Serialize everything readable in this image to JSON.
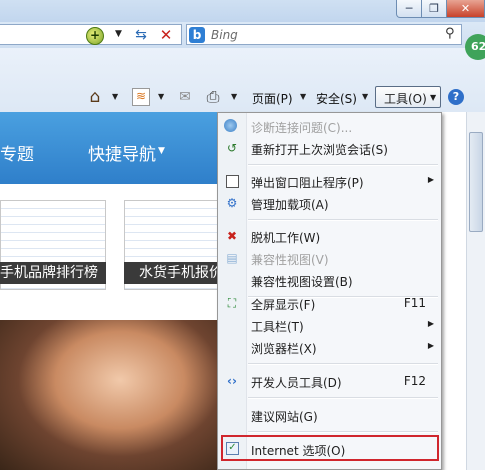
{
  "window": {
    "min_label": "─",
    "max_label": "❐",
    "close_label": "✕"
  },
  "address_bar": {
    "compat_glyph": "+",
    "dropdown_glyph": "▼",
    "refresh_glyph": "⇆",
    "stop_glyph": "✕"
  },
  "search": {
    "engine": "Bing",
    "engine_glyph": "b",
    "search_glyph": "⚲",
    "dropdown_glyph": "▼"
  },
  "command_bar": {
    "home_glyph": "⌂",
    "feeds_glyph": "≋",
    "mail_glyph": "✉",
    "print_glyph": "⎙",
    "arrow_glyph": "▼",
    "page_label": "页面(P)",
    "safety_label": "安全(S)",
    "tools_label": "工具(O)",
    "help_glyph": "?",
    "badge": "62"
  },
  "page": {
    "nav_topic": "专题",
    "nav_quick": "快捷导航",
    "nav_arrow": "▼",
    "thumb1_caption": "手机品牌排行榜",
    "thumb2_caption": "水货手机报价"
  },
  "tools_menu": {
    "items": [
      {
        "label": "诊断连接问题(C)...",
        "shortcut": "",
        "submenu": false,
        "disabled": true,
        "icon": "diagnose-icon"
      },
      {
        "label": "重新打开上次浏览会话(S)",
        "shortcut": "",
        "submenu": false,
        "disabled": false,
        "icon": "reopen-session-icon"
      },
      {
        "label": "弹出窗口阻止程序(P)",
        "shortcut": "",
        "submenu": true,
        "disabled": false,
        "icon": "popup-blocker-icon"
      },
      {
        "label": "管理加载项(A)",
        "shortcut": "",
        "submenu": false,
        "disabled": false,
        "icon": "addons-icon"
      },
      {
        "label": "脱机工作(W)",
        "shortcut": "",
        "submenu": false,
        "disabled": false,
        "icon": "offline-icon"
      },
      {
        "label": "兼容性视图(V)",
        "shortcut": "",
        "submenu": false,
        "disabled": true,
        "icon": "compat-view-icon"
      },
      {
        "label": "兼容性视图设置(B)",
        "shortcut": "",
        "submenu": false,
        "disabled": false,
        "icon": ""
      },
      {
        "label": "全屏显示(F)",
        "shortcut": "F11",
        "submenu": false,
        "disabled": false,
        "icon": "fullscreen-icon"
      },
      {
        "label": "工具栏(T)",
        "shortcut": "",
        "submenu": true,
        "disabled": false,
        "icon": ""
      },
      {
        "label": "浏览器栏(X)",
        "shortcut": "",
        "submenu": true,
        "disabled": false,
        "icon": ""
      },
      {
        "label": "开发人员工具(D)",
        "shortcut": "F12",
        "submenu": false,
        "disabled": false,
        "icon": "dev-tools-icon"
      },
      {
        "label": "建议网站(G)",
        "shortcut": "",
        "submenu": false,
        "disabled": false,
        "icon": ""
      },
      {
        "label": "Internet 选项(O)",
        "shortcut": "",
        "submenu": false,
        "disabled": false,
        "icon": "internet-options-icon"
      }
    ],
    "submenu_glyph": "▶"
  },
  "colors": {
    "nav_band": "#3d8fd6",
    "highlight": "#d0262d",
    "menu_bg": "#f5f7fa",
    "disabled_text": "#a0a0a0"
  }
}
